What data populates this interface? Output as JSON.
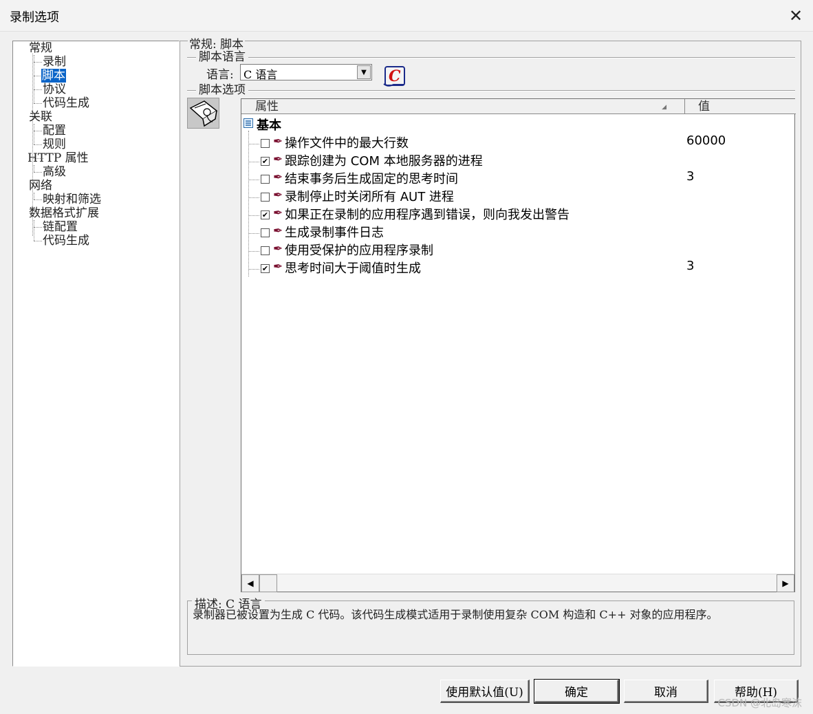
{
  "window": {
    "title": "录制选项",
    "close_glyph": "✕"
  },
  "tree": {
    "items": [
      {
        "label": "常规"
      },
      {
        "label": "录制"
      },
      {
        "label": "脚本",
        "selected": true
      },
      {
        "label": "协议"
      },
      {
        "label": "代码生成"
      },
      {
        "label": "关联"
      },
      {
        "label": "配置"
      },
      {
        "label": "规则"
      },
      {
        "label": "HTTP 属性"
      },
      {
        "label": "高级"
      },
      {
        "label": "网络"
      },
      {
        "label": "映射和筛选"
      },
      {
        "label": "数据格式扩展"
      },
      {
        "label": "链配置"
      },
      {
        "label": "代码生成"
      }
    ]
  },
  "panel": {
    "section_title": "常规: 脚本",
    "script_language_group": "脚本语言",
    "language_label": "语言:",
    "language_value": "C 语言",
    "script_options_group": "脚本选项"
  },
  "grid": {
    "col_property": "属性",
    "col_value": "值",
    "category": "基本",
    "rows": [
      {
        "name": "操作文件中的最大行数",
        "value": "60000",
        "checked": false
      },
      {
        "name": "跟踪创建为 COM 本地服务器的进程",
        "value": "",
        "checked": true
      },
      {
        "name": "结束事务后生成固定的思考时间",
        "value": "3",
        "checked": false
      },
      {
        "name": "录制停止时关闭所有 AUT 进程",
        "value": "",
        "checked": false
      },
      {
        "name": "如果正在录制的应用程序遇到错误，则向我发出警告",
        "value": "",
        "checked": true
      },
      {
        "name": "生成录制事件日志",
        "value": "",
        "checked": false
      },
      {
        "name": "使用受保护的应用程序录制",
        "value": "",
        "checked": false
      },
      {
        "name": "思考时间大于阈值时生成",
        "value": "3",
        "checked": true
      }
    ]
  },
  "description": {
    "label": "描述: C 语言",
    "text": "录制器已被设置为生成 C 代码。该代码生成模式适用于录制使用复杂 COM 构造和 C++ 对象的应用程序。"
  },
  "buttons": {
    "use_default": "使用默认值(U)",
    "ok": "确定",
    "cancel": "取消",
    "help": "帮助(H)"
  },
  "watermark": "CSDN @北岛寒沫"
}
